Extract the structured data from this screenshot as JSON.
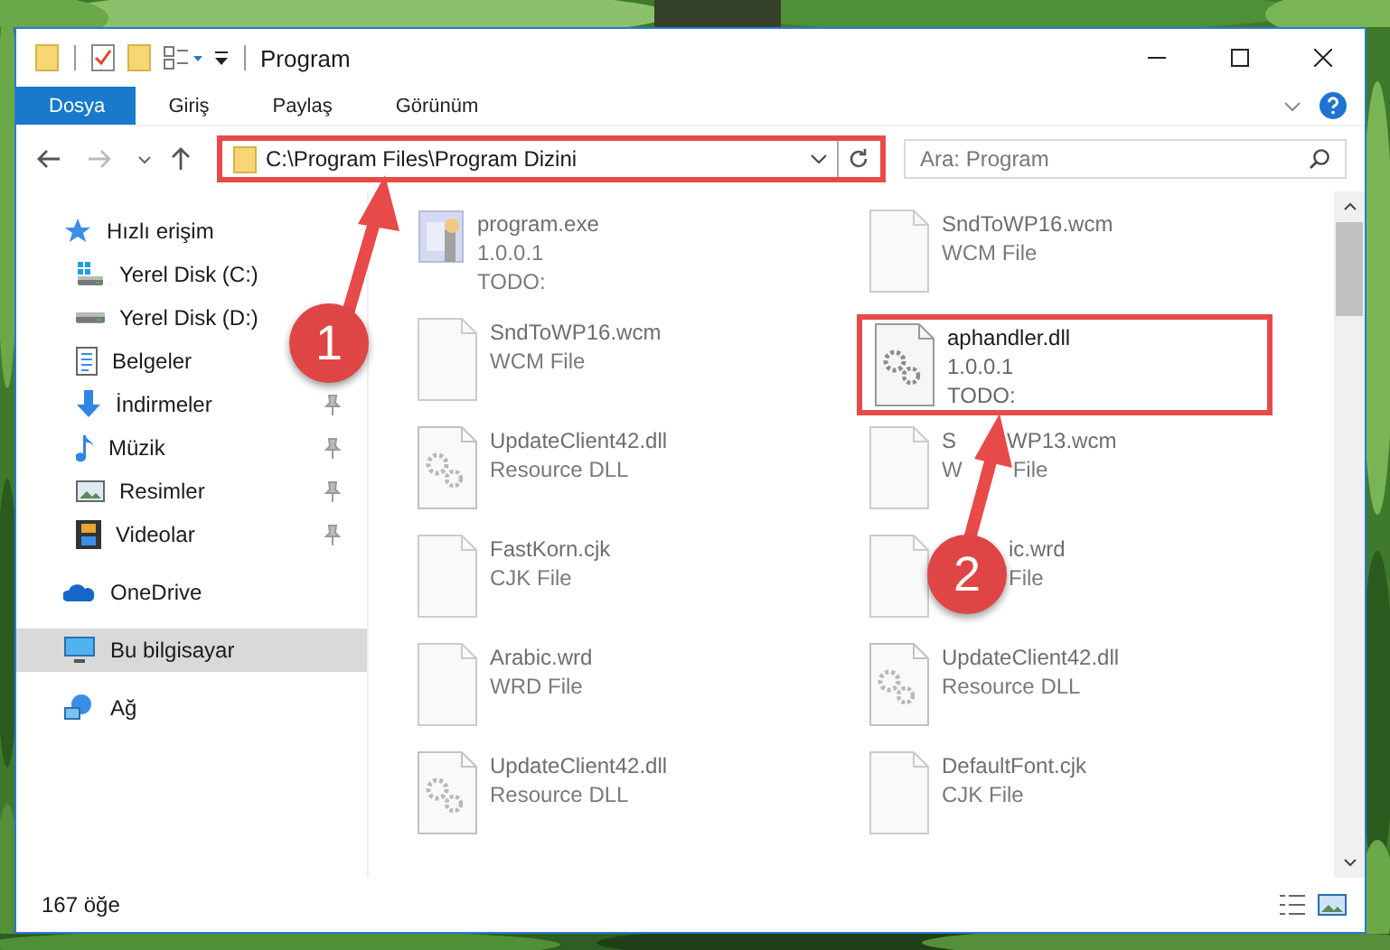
{
  "window": {
    "title": "Program"
  },
  "ribbon": {
    "tabs": [
      {
        "label": "Dosya",
        "selected": true
      },
      {
        "label": "Giriş",
        "selected": false
      },
      {
        "label": "Paylaş",
        "selected": false
      },
      {
        "label": "Görünüm",
        "selected": false
      }
    ]
  },
  "address_bar": {
    "path": "C:\\Program Files\\Program Dizini",
    "highlighted": true
  },
  "search": {
    "placeholder": "Ara: Program"
  },
  "sidebar": {
    "items": [
      {
        "label": "Hızlı erişim",
        "kind": "star",
        "selected": false,
        "pinned": false,
        "children": [
          {
            "label": "Yerel Disk (C:)",
            "kind": "drive-c",
            "selected": false,
            "pinned": false
          },
          {
            "label": "Yerel Disk (D:)",
            "kind": "drive",
            "selected": false,
            "pinned": false
          },
          {
            "label": "Belgeler",
            "kind": "docs",
            "selected": false,
            "pinned": false
          },
          {
            "label": "İndirmeler",
            "kind": "download",
            "selected": false,
            "pinned": true
          },
          {
            "label": "Müzik",
            "kind": "music",
            "selected": false,
            "pinned": true
          },
          {
            "label": "Resimler",
            "kind": "pictures",
            "selected": false,
            "pinned": true
          },
          {
            "label": "Videolar",
            "kind": "video",
            "selected": false,
            "pinned": true
          }
        ]
      },
      {
        "label": "OneDrive",
        "kind": "cloud",
        "selected": false,
        "pinned": false
      },
      {
        "label": "Bu bilgisayar",
        "kind": "pc",
        "selected": true,
        "pinned": false
      },
      {
        "label": "Ağ",
        "kind": "network",
        "selected": false,
        "pinned": false
      }
    ]
  },
  "files": [
    {
      "name": [
        {
          "text": "program.exe",
          "after_gap": false
        }
      ],
      "lines": [
        [
          {
            "text": "1.0.0.1",
            "after_gap": false
          }
        ],
        [
          {
            "text": "TODO:",
            "after_gap": false
          }
        ]
      ],
      "kind": "exe",
      "dimmed": true,
      "highlighted": false
    },
    {
      "name": [
        {
          "text": "SndToWP16.wcm",
          "after_gap": false
        }
      ],
      "lines": [
        [
          {
            "text": "WCM File",
            "after_gap": false
          }
        ]
      ],
      "kind": "file",
      "dimmed": true,
      "highlighted": false
    },
    {
      "name": [
        {
          "text": "SndToWP16.wcm",
          "after_gap": false
        }
      ],
      "lines": [
        [
          {
            "text": "WCM File",
            "after_gap": false
          }
        ]
      ],
      "kind": "file",
      "dimmed": true,
      "highlighted": false
    },
    {
      "name": [
        {
          "text": "aphandler.dll",
          "after_gap": false
        }
      ],
      "lines": [
        [
          {
            "text": "1.0.0.1",
            "after_gap": false
          }
        ],
        [
          {
            "text": "TODO:",
            "after_gap": false
          }
        ]
      ],
      "kind": "dll",
      "dimmed": false,
      "highlighted": true
    },
    {
      "name": [
        {
          "text": "UpdateClient42.dll",
          "after_gap": false
        }
      ],
      "lines": [
        [
          {
            "text": "Resource DLL",
            "after_gap": false
          }
        ]
      ],
      "kind": "dll",
      "dimmed": true,
      "highlighted": false
    },
    {
      "name": [
        {
          "text": "S",
          "after_gap": false
        },
        {
          "text": "WP13.wcm",
          "after_gap": true
        }
      ],
      "lines": [
        [
          {
            "text": "W",
            "after_gap": false
          },
          {
            "text": "File",
            "after_gap": true
          }
        ]
      ],
      "kind": "file",
      "dimmed": true,
      "highlighted": false
    },
    {
      "name": [
        {
          "text": "FastKorn.cjk",
          "after_gap": false
        }
      ],
      "lines": [
        [
          {
            "text": "CJK File",
            "after_gap": false
          }
        ]
      ],
      "kind": "file",
      "dimmed": true,
      "highlighted": false
    },
    {
      "name": [
        {
          "text": "ic.wrd",
          "after_gap": true
        }
      ],
      "lines": [
        [
          {
            "text": "File",
            "after_gap": true
          }
        ]
      ],
      "kind": "file",
      "dimmed": true,
      "highlighted": false
    },
    {
      "name": [
        {
          "text": "Arabic.wrd",
          "after_gap": false
        }
      ],
      "lines": [
        [
          {
            "text": "WRD File",
            "after_gap": false
          }
        ]
      ],
      "kind": "file",
      "dimmed": true,
      "highlighted": false
    },
    {
      "name": [
        {
          "text": "UpdateClient42.dll",
          "after_gap": false
        }
      ],
      "lines": [
        [
          {
            "text": "Resource DLL",
            "after_gap": false
          }
        ]
      ],
      "kind": "dll",
      "dimmed": true,
      "highlighted": false
    },
    {
      "name": [
        {
          "text": "UpdateClient42.dll",
          "after_gap": false
        }
      ],
      "lines": [
        [
          {
            "text": "Resource DLL",
            "after_gap": false
          }
        ]
      ],
      "kind": "dll",
      "dimmed": true,
      "highlighted": false
    },
    {
      "name": [
        {
          "text": "DefaultFont.cjk",
          "after_gap": false
        }
      ],
      "lines": [
        [
          {
            "text": "CJK File",
            "after_gap": false
          }
        ]
      ],
      "kind": "file",
      "dimmed": true,
      "highlighted": false
    }
  ],
  "status_bar": {
    "count": "167 öğe"
  },
  "callouts": [
    {
      "label": "1"
    },
    {
      "label": "2"
    }
  ]
}
